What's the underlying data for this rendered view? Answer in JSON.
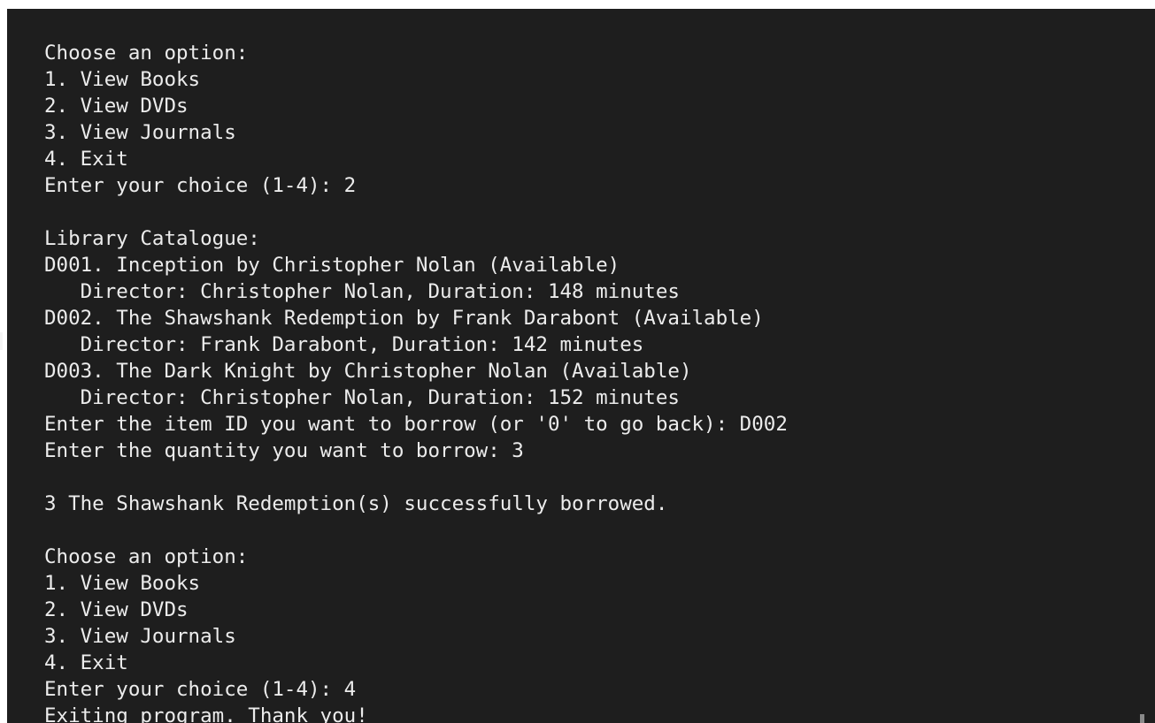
{
  "colors": {
    "background": "#1e1e1e",
    "text": "#ececec"
  },
  "terminal": {
    "first_menu": {
      "prompt": "Choose an option:",
      "opt1": "1. View Books",
      "opt2": "2. View DVDs",
      "opt3": "3. View Journals",
      "opt4": "4. Exit",
      "choice": "Enter your choice (1-4): 2"
    },
    "catalogue": {
      "heading": "Library Catalogue:",
      "d001_title": "D001. Inception by Christopher Nolan (Available)",
      "d001_detail": "   Director: Christopher Nolan, Duration: 148 minutes",
      "d002_title": "D002. The Shawshank Redemption by Frank Darabont (Available)",
      "d002_detail": "   Director: Frank Darabont, Duration: 142 minutes",
      "d003_title": "D003. The Dark Knight by Christopher Nolan (Available)",
      "d003_detail": "   Director: Christopher Nolan, Duration: 152 minutes",
      "borrow_id_prompt": "Enter the item ID you want to borrow (or '0' to go back): D002",
      "quantity_prompt": "Enter the quantity you want to borrow: 3"
    },
    "result": "3 The Shawshank Redemption(s) successfully borrowed.",
    "second_menu": {
      "prompt": "Choose an option:",
      "opt1": "1. View Books",
      "opt2": "2. View DVDs",
      "opt3": "3. View Journals",
      "opt4": "4. Exit",
      "choice": "Enter your choice (1-4): 4"
    },
    "exit_message": "Exiting program. Thank you!"
  }
}
